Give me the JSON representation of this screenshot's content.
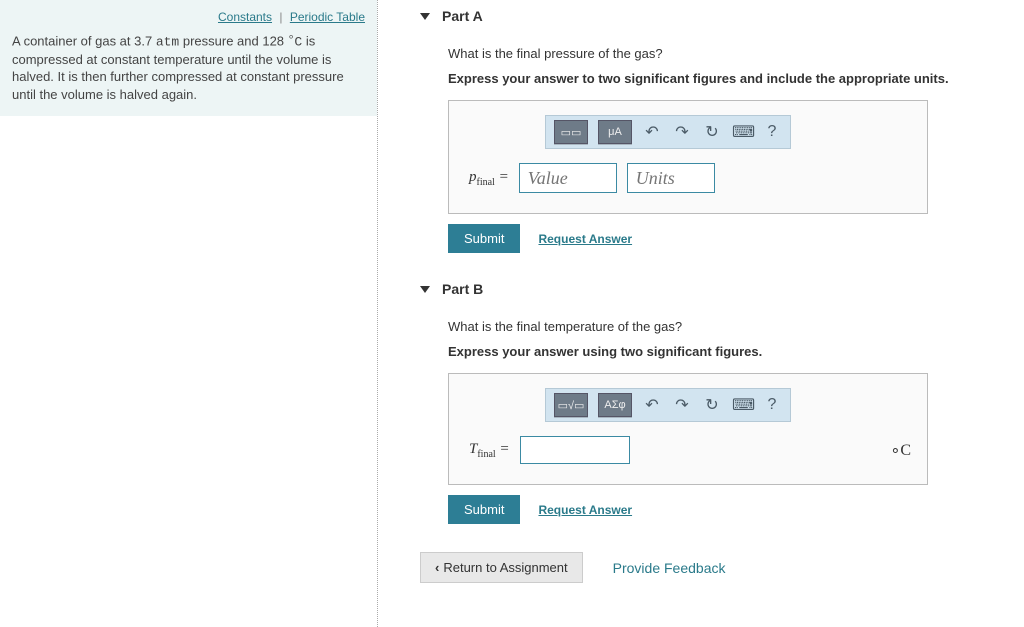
{
  "problem": {
    "links": {
      "constants": "Constants",
      "periodic": "Periodic Table"
    },
    "text_prefix": "A container of gas at 3.7 ",
    "atm": "atm",
    "text_mid": " pressure and 128 ",
    "deg": "∘",
    "unitC": "C",
    "text_suffix": " is compressed at constant temperature until the volume is halved. It is then further compressed at constant pressure until the volume is halved again."
  },
  "parts": {
    "a": {
      "title": "Part A",
      "question": "What is the final pressure of the gas?",
      "instruct": "Express your answer to two significant figures and include the appropriate units.",
      "var_sym": "p",
      "var_sub": "final",
      "eq": " = ",
      "value_ph": "Value",
      "units_ph": "Units",
      "tool2": "μA"
    },
    "b": {
      "title": "Part B",
      "question": "What is the final temperature of the gas?",
      "instruct": "Express your answer using two significant figures.",
      "var_sym": "T",
      "var_sub": "final",
      "eq": " = ",
      "unit_suffix": "∘C",
      "tool2": "ΑΣφ"
    }
  },
  "common": {
    "submit": "Submit",
    "request": "Request Answer",
    "undo": "↶",
    "redo": "↷",
    "reset": "↻",
    "keyboard": "⌨",
    "help": "?",
    "return": "Return to Assignment",
    "feedback": "Provide Feedback"
  }
}
